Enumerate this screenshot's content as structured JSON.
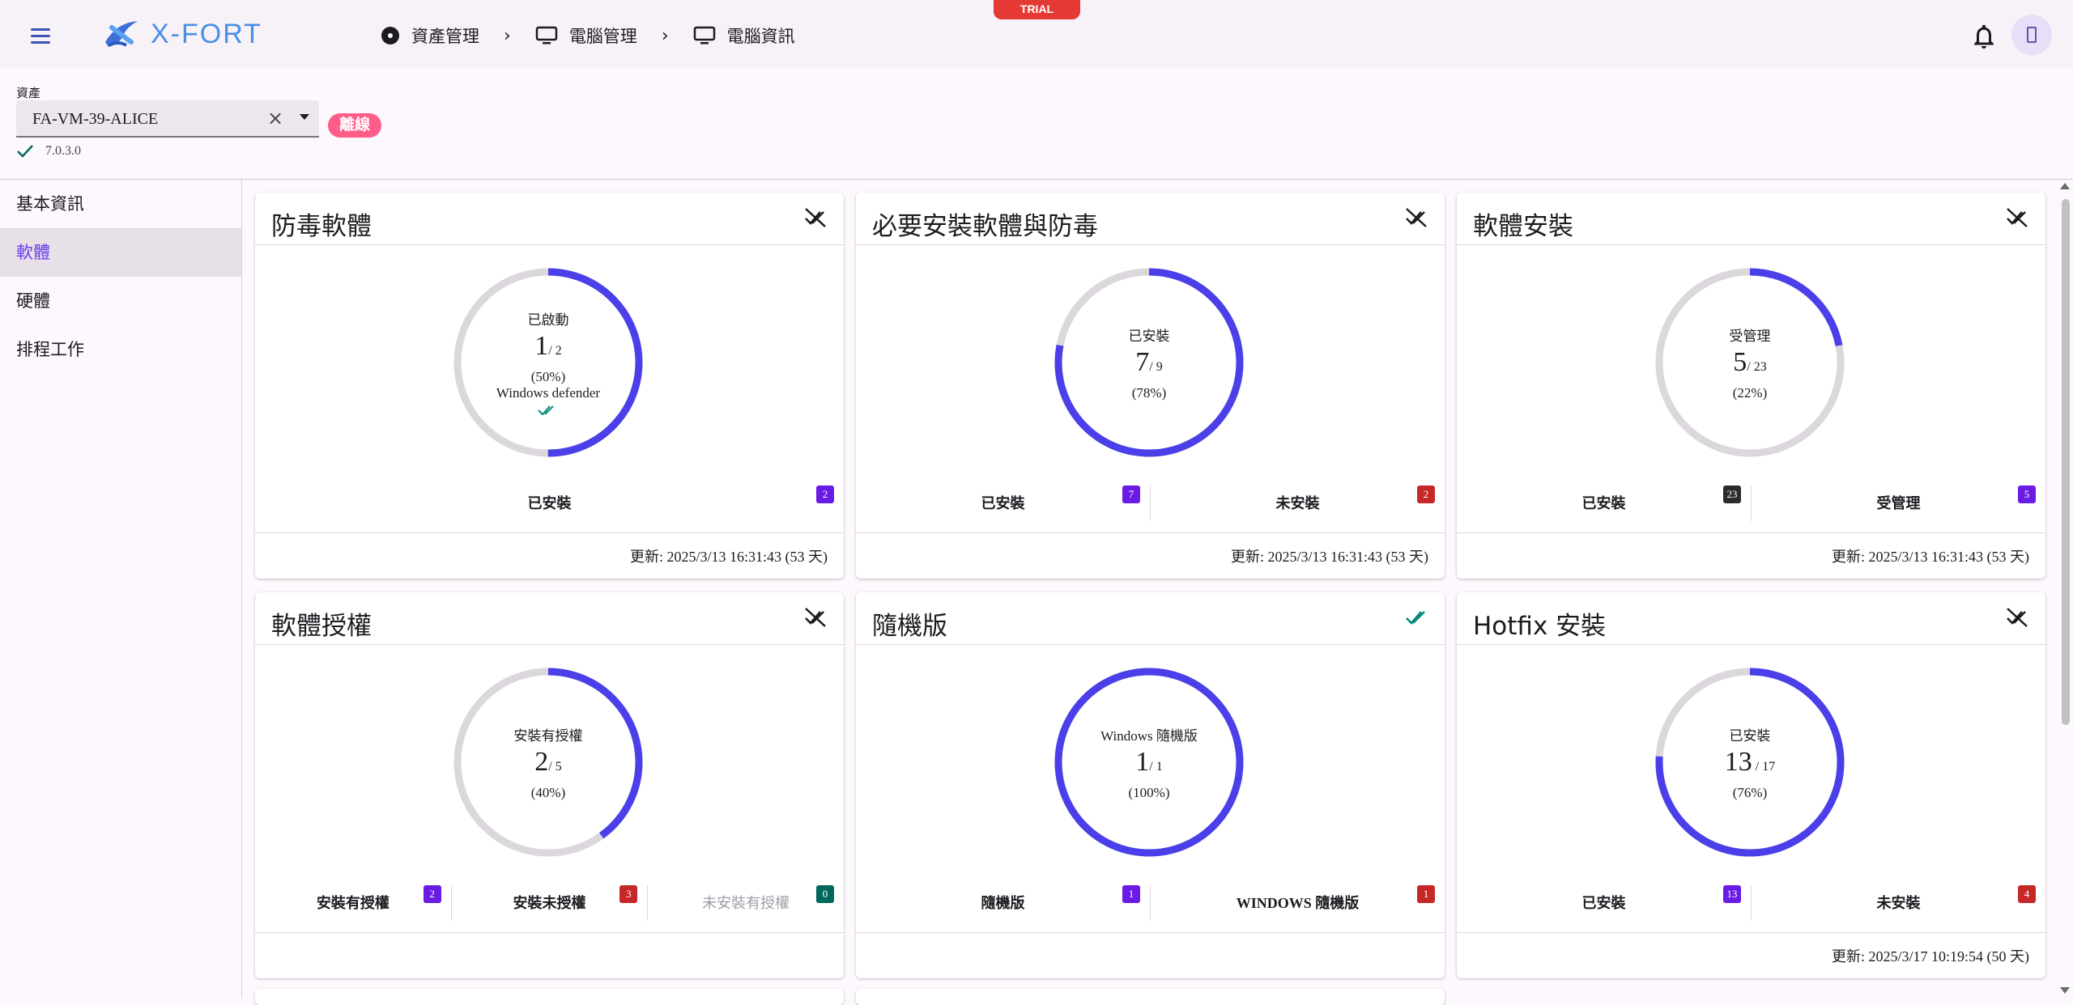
{
  "header": {
    "trial_label": "TRIAL",
    "logo_text": "X-FORT",
    "breadcrumbs": [
      {
        "icon": "disc-icon",
        "label": "資產管理"
      },
      {
        "icon": "monitor-icon",
        "label": "電腦管理"
      },
      {
        "icon": "monitor-icon",
        "label": "電腦資訊"
      }
    ]
  },
  "asset": {
    "label": "資產",
    "value": "FA-VM-39-ALICE",
    "status": "離線",
    "version": "7.0.3.0"
  },
  "sidebar": {
    "items": [
      {
        "label": "基本資訊",
        "active": false
      },
      {
        "label": "軟體",
        "active": true
      },
      {
        "label": "硬體",
        "active": false
      },
      {
        "label": "排程工作",
        "active": false
      }
    ]
  },
  "colors": {
    "accent": "#4a3fe8",
    "track": "#dbd7dc",
    "active_nav": "#6a3de8",
    "offline": "#ff5c8a"
  },
  "cards": [
    {
      "title": "防毒軟體",
      "icon": "disconnected-icon",
      "center": {
        "label": "已啟動",
        "value": "1",
        "total": "/ 2",
        "percent": "(50%)",
        "note": "Windows defender",
        "check": true
      },
      "progress": 0.5,
      "legend": [
        {
          "label": "已安裝",
          "badge": "2",
          "badge_color": "purple",
          "dim": false
        }
      ],
      "updated": "更新: 2025/3/13 16:31:43 (53 天)"
    },
    {
      "title": "必要安裝軟體與防毒",
      "icon": "disconnected-icon",
      "center": {
        "label": "已安裝",
        "value": "7",
        "total": "/ 9",
        "percent": "(78%)",
        "note": "",
        "check": false
      },
      "progress": 0.78,
      "legend": [
        {
          "label": "已安裝",
          "badge": "7",
          "badge_color": "purple",
          "dim": false
        },
        {
          "label": "未安裝",
          "badge": "2",
          "badge_color": "red",
          "dim": false
        }
      ],
      "updated": "更新: 2025/3/13 16:31:43 (53 天)"
    },
    {
      "title": "軟體安裝",
      "icon": "disconnected-icon",
      "center": {
        "label": "受管理",
        "value": "5",
        "total": "/ 23",
        "percent": "(22%)",
        "note": "",
        "check": false
      },
      "progress": 0.22,
      "legend": [
        {
          "label": "已安裝",
          "badge": "23",
          "badge_color": "dark",
          "dim": false
        },
        {
          "label": "受管理",
          "badge": "5",
          "badge_color": "purple",
          "dim": false
        }
      ],
      "updated": "更新: 2025/3/13 16:31:43 (53 天)"
    },
    {
      "title": "軟體授權",
      "icon": "disconnected-icon",
      "center": {
        "label": "安裝有授權",
        "value": "2",
        "total": "/ 5",
        "percent": "(40%)",
        "note": "",
        "check": false
      },
      "progress": 0.4,
      "legend": [
        {
          "label": "安裝有授權",
          "badge": "2",
          "badge_color": "purple",
          "dim": false
        },
        {
          "label": "安裝未授權",
          "badge": "3",
          "badge_color": "red",
          "dim": false
        },
        {
          "label": "未安裝有授權",
          "badge": "0",
          "badge_color": "teal",
          "dim": true
        }
      ],
      "updated": ""
    },
    {
      "title": "隨機版",
      "icon": "double-check-icon",
      "center": {
        "label": "Windows 隨機版",
        "value": "1",
        "total": "/ 1",
        "percent": "(100%)",
        "note": "",
        "check": false
      },
      "progress": 1.0,
      "legend": [
        {
          "label": "隨機版",
          "badge": "1",
          "badge_color": "purple",
          "dim": false
        },
        {
          "label": "WINDOWS 隨機版",
          "badge": "1",
          "badge_color": "red",
          "dim": false
        }
      ],
      "updated": ""
    },
    {
      "title": "Hotfix 安裝",
      "icon": "disconnected-icon",
      "center": {
        "label": "已安裝",
        "value": "13",
        "total": " / 17",
        "percent": "(76%)",
        "note": "",
        "check": false
      },
      "progress": 0.76,
      "legend": [
        {
          "label": "已安裝",
          "badge": "13",
          "badge_color": "purple",
          "dim": false
        },
        {
          "label": "未安裝",
          "badge": "4",
          "badge_color": "red",
          "dim": false
        }
      ],
      "updated": "更新: 2025/3/17 10:19:54 (50 天)"
    }
  ]
}
